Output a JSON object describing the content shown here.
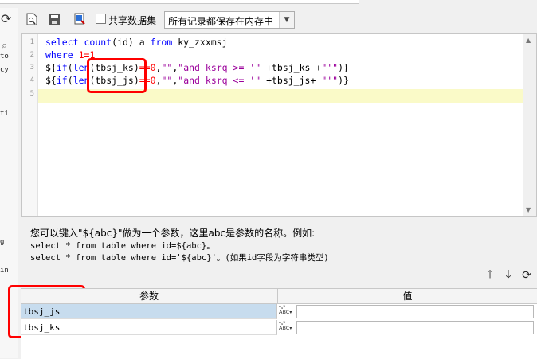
{
  "toolbar": {
    "share_label": "共享数据集",
    "storage_value": "所有记录都保存在内存中"
  },
  "left_panel": {
    "fragments": [
      "to",
      "cy",
      "ti",
      "g",
      "in"
    ]
  },
  "editor": {
    "line_numbers": [
      "1",
      "2",
      "3",
      "4",
      "5"
    ],
    "lines": [
      "select count(id) a from ky_zxxmsj",
      "where 1=1",
      "${if(len(tbsj_ks)==0,\"\",\"and ksrq >= '\" +tbsj_ks +\"'\")}",
      "${if(len(tbsj_js)==0,\"\",\"and ksrq <= '\" +tbsj_js+ \"'\")}",
      ""
    ]
  },
  "hint": {
    "line1": "您可以键入\"${abc}\"做为一个参数，这里abc是参数的名称。例如:",
    "line2": "select * from table where id=${abc}。",
    "line3": "select * from table where id='${abc}'。(如果id字段为字符串类型)"
  },
  "params": {
    "col_param": "参数",
    "col_value": "值",
    "rows": [
      {
        "name": "tbsj_js",
        "value": ""
      },
      {
        "name": "tbsj_ks",
        "value": ""
      }
    ],
    "abc_top": "ᴬᵤᵁ",
    "abc_bottom": "ABC"
  },
  "colors": {
    "keyword": "#0000ff",
    "string": "#9b009b",
    "number": "#ff0000",
    "highlight_line": "#fafac8",
    "annotation": "#ff0000",
    "selected_row": "#c7dcee"
  }
}
